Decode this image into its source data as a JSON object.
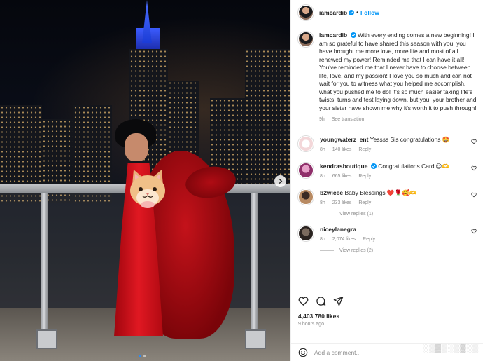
{
  "post": {
    "username": "iamcardib",
    "follow_label": "Follow",
    "caption": "With every ending comes a new beginning! I am so grateful to have shared this season with you, you have brought me more love, more life and most of all renewed my power! Reminded me that I can have it all! You've reminded me that I never have to choose between life, love, and my passion! I love you so much and can not wait for you to witness what you helped me accomplish, what you pushed me to do! It's so much easier taking life's twists, turns and test laying down, but you, your brother and your sister have shown me why it's worth it to push through!",
    "caption_age": "9h",
    "see_translation": "See translation",
    "likes": "4,403,780 likes",
    "posted": "9 hours ago",
    "add_comment_placeholder": "Add a comment..."
  },
  "comments": [
    {
      "username": "youngwaterz_ent",
      "text": "Yessss Sis congratulations 🤩",
      "age": "8h",
      "likes": "140 likes",
      "reply": "Reply",
      "verified": false
    },
    {
      "username": "kendrasboutique",
      "text": "Congratulations Cardi😍🫶",
      "age": "8h",
      "likes": "665 likes",
      "reply": "Reply",
      "verified": true
    },
    {
      "username": "b2wicee",
      "text": "Baby Blessings ❤️🌹🥰🫶",
      "age": "8h",
      "likes": "233 likes",
      "reply": "Reply",
      "verified": false,
      "view_replies": "View replies (1)"
    },
    {
      "username": "niceylanegra",
      "text": "",
      "age": "8h",
      "likes": "2,074 likes",
      "reply": "Reply",
      "verified": false,
      "view_replies": "View replies (2)"
    }
  ],
  "colors": {
    "accent": "#0095f6",
    "text": "#262626",
    "muted": "#8e8e8e",
    "verified": "#0095f6"
  },
  "icons": [
    "verified-badge-icon",
    "heart-icon",
    "comment-icon",
    "share-icon",
    "emoji-icon",
    "chevron-right-icon"
  ]
}
